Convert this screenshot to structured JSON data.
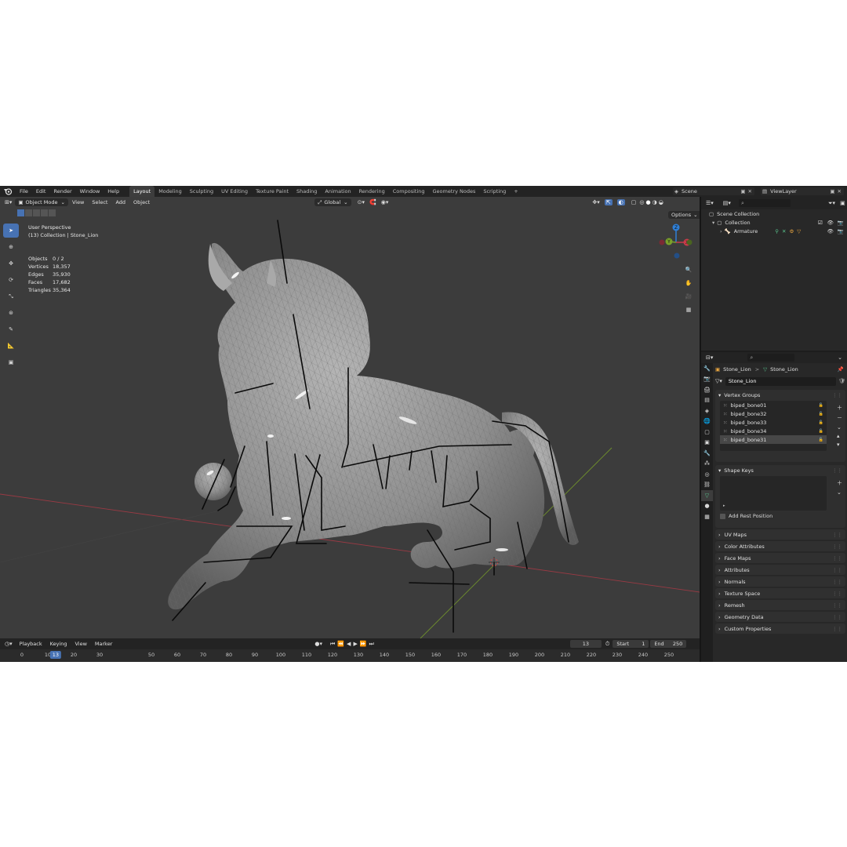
{
  "menu": [
    "File",
    "Edit",
    "Render",
    "Window",
    "Help"
  ],
  "workspaces": [
    "Layout",
    "Modeling",
    "Sculpting",
    "UV Editing",
    "Texture Paint",
    "Shading",
    "Animation",
    "Rendering",
    "Compositing",
    "Geometry Nodes",
    "Scripting"
  ],
  "active_workspace": "Layout",
  "add_tab": "+",
  "scene": "Scene",
  "view_layer": "ViewLayer",
  "viewport": {
    "mode": "Object Mode",
    "menus": [
      "View",
      "Select",
      "Add",
      "Object"
    ],
    "orientation": "Global",
    "options": "Options",
    "perspective": "User Perspective",
    "collection_info": "(13) Collection | Stone_Lion",
    "stats": [
      {
        "k": "Objects",
        "v": "0 / 2"
      },
      {
        "k": "Vertices",
        "v": "18,357"
      },
      {
        "k": "Edges",
        "v": "35,930"
      },
      {
        "k": "Faces",
        "v": "17,682"
      },
      {
        "k": "Triangles",
        "v": "35,364"
      }
    ],
    "gizmo": {
      "z": "Z",
      "y": "Y",
      "x": "X"
    },
    "colors": {
      "x_axis": "#c83a4a",
      "y_axis": "#7aa02a",
      "z_axis": "#2f7fd6",
      "bg": "#3c3c3c",
      "mesh": "#9c9c9c"
    }
  },
  "outliner": {
    "search_placeholder": "",
    "scene_collection": "Scene Collection",
    "collection": "Collection",
    "armature": "Armature"
  },
  "properties": {
    "breadcrumb_object": "Stone_Lion",
    "breadcrumb_sep": ">",
    "breadcrumb_data": "Stone_Lion",
    "mesh_name": "Stone_Lion",
    "vertex_groups_title": "Vertex Groups",
    "vertex_groups": [
      "biped_bone01",
      "biped_bone32",
      "biped_bone33",
      "biped_bone34",
      "biped_bone31"
    ],
    "selected_vertex_group": "biped_bone31",
    "shape_keys_title": "Shape Keys",
    "add_rest_position": "Add Rest Position",
    "closed_panels": [
      "UV Maps",
      "Color Attributes",
      "Face Maps",
      "Attributes",
      "Normals",
      "Texture Space",
      "Remesh",
      "Geometry Data",
      "Custom Properties"
    ]
  },
  "timeline": {
    "menus": [
      "Playback",
      "Keying",
      "View",
      "Marker"
    ],
    "current_frame": "13",
    "start_label": "Start",
    "start": "1",
    "end_label": "End",
    "end": "250",
    "ticks": [
      "0",
      "10",
      "20",
      "30",
      "50",
      "60",
      "70",
      "80",
      "90",
      "100",
      "110",
      "120",
      "130",
      "140",
      "150",
      "160",
      "170",
      "180",
      "190",
      "200",
      "210",
      "220",
      "230",
      "240",
      "250"
    ],
    "playhead": "13"
  }
}
